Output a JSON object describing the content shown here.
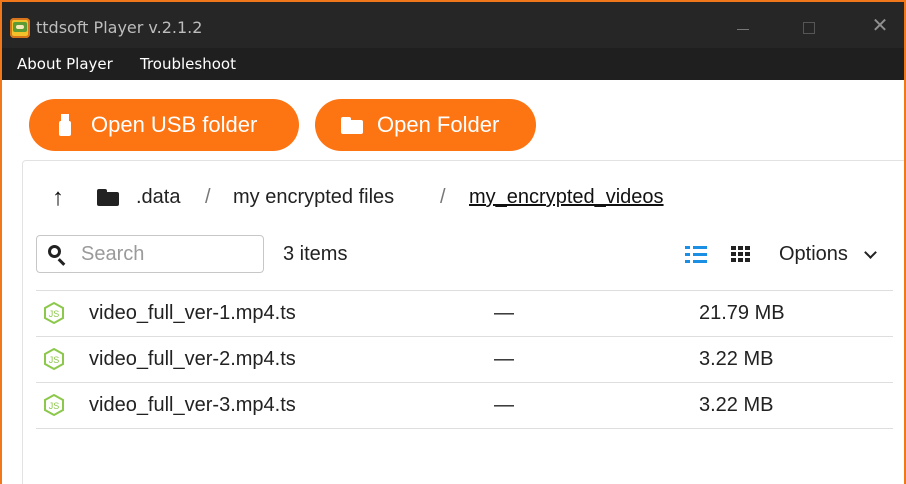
{
  "window": {
    "title": "ttdsoft Player v.2.1.2",
    "close_glyph": "✕"
  },
  "menu": {
    "items": [
      "About Player",
      "Troubleshoot"
    ]
  },
  "toolbar": {
    "open_usb_label": "Open USB folder",
    "open_folder_label": "Open Folder",
    "accent_color": "#fd7413"
  },
  "breadcrumb": {
    "up_glyph": "↑",
    "separator": "/",
    "items": [
      ".data",
      "my encrypted files",
      "my_encrypted_videos"
    ]
  },
  "filter": {
    "search_placeholder": "Search",
    "search_value": "",
    "item_count": "3 items",
    "options_label": "Options"
  },
  "files": [
    {
      "name": "video_full_ver-1.mp4.ts",
      "modified": "—",
      "size": "21.79 MB",
      "icon": "nodejs-file-icon"
    },
    {
      "name": "video_full_ver-2.mp4.ts",
      "modified": "—",
      "size": "3.22 MB",
      "icon": "nodejs-file-icon"
    },
    {
      "name": "video_full_ver-3.mp4.ts",
      "modified": "—",
      "size": "3.22 MB",
      "icon": "nodejs-file-icon"
    }
  ]
}
